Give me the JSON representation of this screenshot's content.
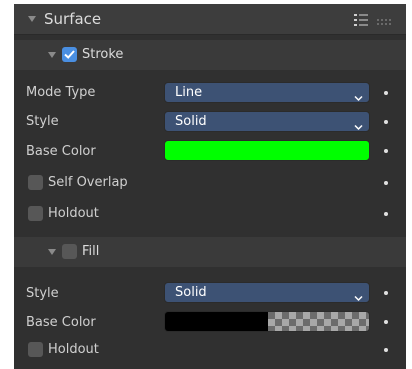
{
  "panel": {
    "title": "Surface",
    "list_icon": "list-icon",
    "drag_icon": "drag-handle-icon"
  },
  "stroke": {
    "label": "Stroke",
    "checked": true,
    "mode_type": {
      "label": "Mode Type",
      "value": "Line"
    },
    "style": {
      "label": "Style",
      "value": "Solid"
    },
    "base_color": {
      "label": "Base Color",
      "color": "#00ff00"
    },
    "self_overlap": {
      "label": "Self Overlap",
      "checked": false
    },
    "holdout": {
      "label": "Holdout",
      "checked": false
    }
  },
  "fill": {
    "label": "Fill",
    "checked": false,
    "style": {
      "label": "Style",
      "value": "Solid"
    },
    "base_color": {
      "label": "Base Color",
      "color": "#000000",
      "alpha": "transparent"
    },
    "holdout": {
      "label": "Holdout",
      "checked": false
    }
  },
  "colors": {
    "panel_bg": "#303030",
    "header_bg": "#3d3d3d",
    "dropdown_bg": "#3d5274",
    "checkbox_on": "#4a8fe2",
    "checkbox_off": "#575757"
  }
}
